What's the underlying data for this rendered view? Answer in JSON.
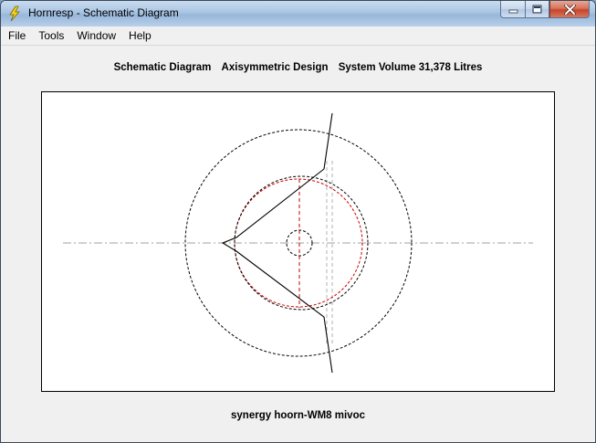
{
  "window": {
    "title": "Hornresp - Schematic Diagram"
  },
  "menu": {
    "items": [
      "File",
      "Tools",
      "Window",
      "Help"
    ]
  },
  "caption_buttons": {
    "minimize_icon": "minimize-icon",
    "maximize_icon": "maximize-icon",
    "close_icon": "close-icon"
  },
  "diagram": {
    "heading": {
      "part1": "Schematic Diagram",
      "part2": "Axisymmetric Design",
      "part3": "System Volume 31,378 Litres"
    },
    "footer": "synergy hoorn-WM8 mivoc",
    "colors": {
      "profile": "#000000",
      "outer_circle": "#000000",
      "inner_red": "#cc0000",
      "centerline": "#a0a0a0",
      "verticals": "#b0b0b0"
    }
  }
}
